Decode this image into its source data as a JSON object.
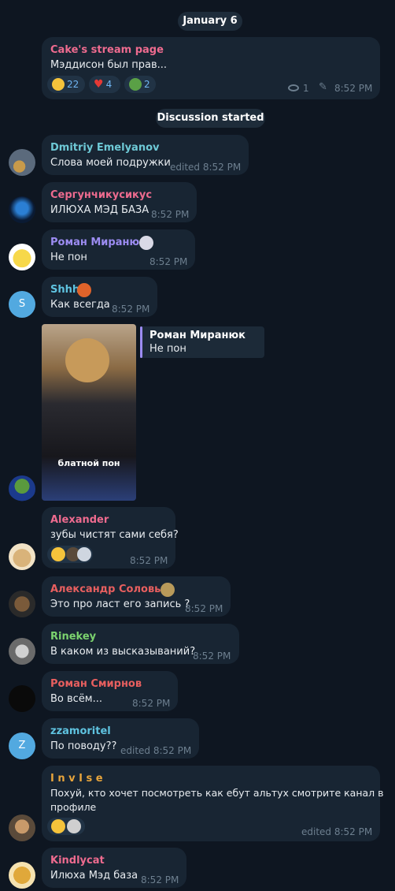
{
  "date_pill": "January 6",
  "channel_post": {
    "author": "Cake's stream page",
    "text": "Мэддисон был прав...",
    "reactions": [
      {
        "emoji": "grinning-face-icon",
        "count": "22"
      },
      {
        "emoji": "heart-icon",
        "count": "4"
      },
      {
        "emoji": "pepe-frog-icon",
        "count": "2"
      }
    ],
    "views": "1",
    "time": "8:52 PM"
  },
  "discussion_pill": "Discussion started",
  "messages": [
    {
      "author": "Dmitriy Emelyanov",
      "text": "Слова моей подружки",
      "time": "edited 8:52 PM",
      "color": "#6ec9d6"
    },
    {
      "author": "Сергунчикусикус",
      "text": "ИЛЮХА МЭД БАЗА",
      "time": "8:52 PM",
      "color": "#ee6b8f"
    },
    {
      "author": "Роман Миранюк",
      "text": "Не пон",
      "time": "8:52 PM",
      "color": "#9c8cf2"
    },
    {
      "author": "Shhh",
      "text": "Как всегда",
      "time": "8:52 PM",
      "color": "#5fc3e0"
    },
    {
      "author": "Alexander",
      "text": "зубы чистят сами себя?",
      "time": "8:52 PM",
      "color": "#ee6b8f"
    },
    {
      "author": "Александр Соловьев",
      "text": "Это про ласт его запись ?",
      "time": "8:52 PM",
      "color": "#e85f5f"
    },
    {
      "author": "Rinekey",
      "text": "В каком из высказываний?",
      "time": "8:52 PM",
      "color": "#7bd26e"
    },
    {
      "author": "Роман Смирнов",
      "text": "Во всём...",
      "time": "8:52 PM",
      "color": "#e85f5f"
    },
    {
      "author": "zzamoritel",
      "text": "По поводу??",
      "time": "edited 8:52 PM",
      "color": "#5fc3e0"
    },
    {
      "author": "I n v I s e",
      "text_line1": "Похуй, кто хочет посмотреть как ебут альтух смотрите канал в",
      "text_line2": "профиле",
      "time": "edited 8:52 PM",
      "color": "#e8a53c"
    },
    {
      "author": "Kindlycat",
      "text": "Илюха Мэд база",
      "time": "8:52 PM",
      "color": "#ee6b8f"
    }
  ],
  "sticker_reply": {
    "reply_author": "Роман Миранюк",
    "reply_text": "Не пон",
    "sticker_caption": "блатной пон"
  },
  "avatar_letters": {
    "shhh": "S",
    "zzamoritel": "Z"
  }
}
